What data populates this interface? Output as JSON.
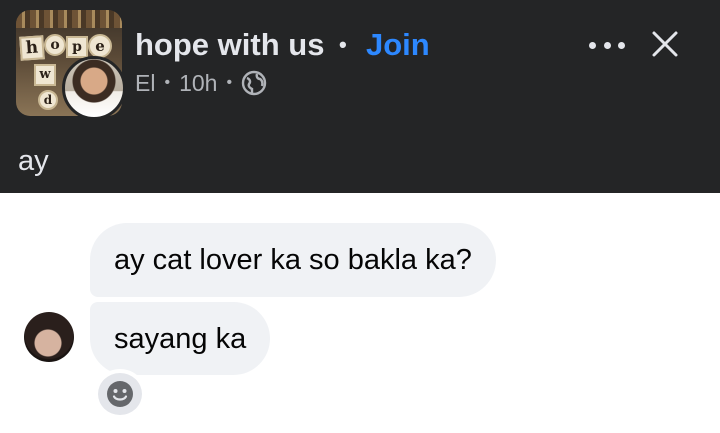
{
  "post": {
    "group_name": "hope with us",
    "separator": "•",
    "join_label": "Join",
    "author": "El",
    "meta_separator": "•",
    "time_ago": "10h",
    "privacy_icon": "globe-icon",
    "text": "ay"
  },
  "group_avatar": {
    "letters": [
      "h",
      "o",
      "p",
      "e",
      "w",
      "d"
    ]
  },
  "header_actions": {
    "more_icon": "more-dots-icon",
    "close_icon": "close-icon"
  },
  "chat": {
    "messages": [
      {
        "text": "ay cat lover ka so bakla ka?"
      },
      {
        "text": "sayang ka"
      }
    ],
    "reaction_icon": "smiley-icon"
  },
  "colors": {
    "header_bg": "#242526",
    "primary_text": "#e4e6eb",
    "secondary_text": "#b0b3b8",
    "link_blue": "#2d88ff",
    "bubble_bg": "#f0f2f5"
  }
}
